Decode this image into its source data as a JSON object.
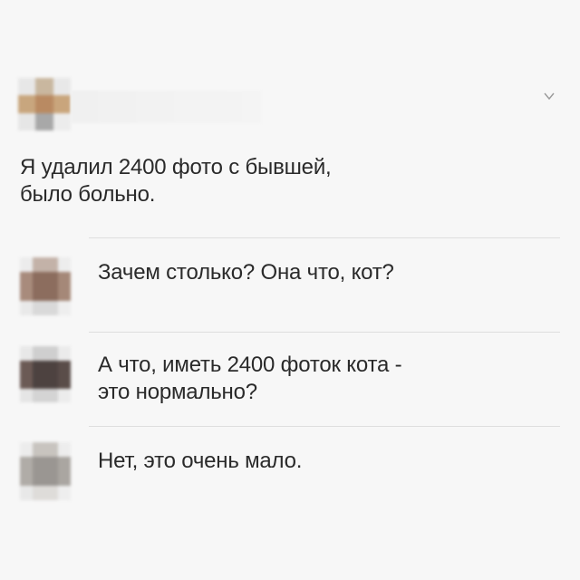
{
  "post": {
    "author_avatar_colors": [
      "#b98a62",
      "#c8a67e",
      "#a8a8a8"
    ],
    "text_lines": [
      "Я удалил 2400 фото с бывшей,",
      "было больно."
    ]
  },
  "header": {
    "menu_icon": "chevron-down-icon"
  },
  "comments": [
    {
      "avatar_colors": [
        "#8c6d5e",
        "#c3b2a8",
        "#d9d9d9"
      ],
      "text_lines": [
        "Зачем столько? Она что, кот?"
      ]
    },
    {
      "avatar_colors": [
        "#4d4240",
        "#6b5a55",
        "#cfcfcf"
      ],
      "text_lines": [
        "А что, иметь 2400 фоток кота -",
        "это нормально?"
      ]
    },
    {
      "avatar_colors": [
        "#9a9692",
        "#c8c4bf",
        "#dedcd9"
      ],
      "text_lines": [
        "Нет, это очень мало."
      ]
    }
  ]
}
